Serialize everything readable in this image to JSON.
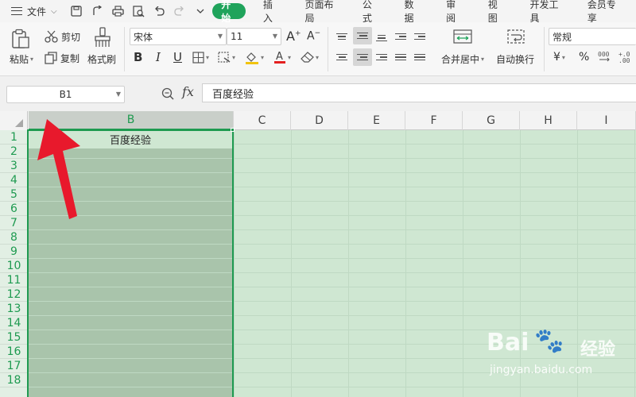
{
  "menu": {
    "file_label": "文件",
    "tabs": [
      "开始",
      "插入",
      "页面布局",
      "公式",
      "数据",
      "审阅",
      "视图",
      "开发工具",
      "会员专享"
    ],
    "active_tab": "开始"
  },
  "ribbon": {
    "paste": "粘贴",
    "cut": "剪切",
    "copy": "复制",
    "format_painter": "格式刷",
    "font_name": "宋体",
    "font_size": "11",
    "merge_center": "合并居中",
    "wrap_text": "自动换行",
    "number_format": "常规",
    "currency_symbol": "¥",
    "percent_symbol": "%"
  },
  "formula_bar": {
    "name_box": "B1",
    "fx_label": "fx",
    "content": "百度经验"
  },
  "sheet": {
    "columns": [
      "B",
      "C",
      "D",
      "E",
      "F",
      "G",
      "H",
      "I"
    ],
    "selected_column": "B",
    "rows": [
      "1",
      "2",
      "3",
      "4",
      "5",
      "6",
      "7",
      "8",
      "9",
      "10",
      "11",
      "12",
      "13",
      "14",
      "15",
      "16",
      "17",
      "18"
    ],
    "cell_b1": "百度经验"
  },
  "watermark": {
    "logo": "Bai",
    "logo2": "经验",
    "url": "jingyan.baidu.com"
  },
  "colors": {
    "accent": "#1fa35b",
    "selection_fill": "#cfe7d2",
    "column_fill": "#a9c4ab",
    "annotation_arrow": "#e8192c"
  }
}
